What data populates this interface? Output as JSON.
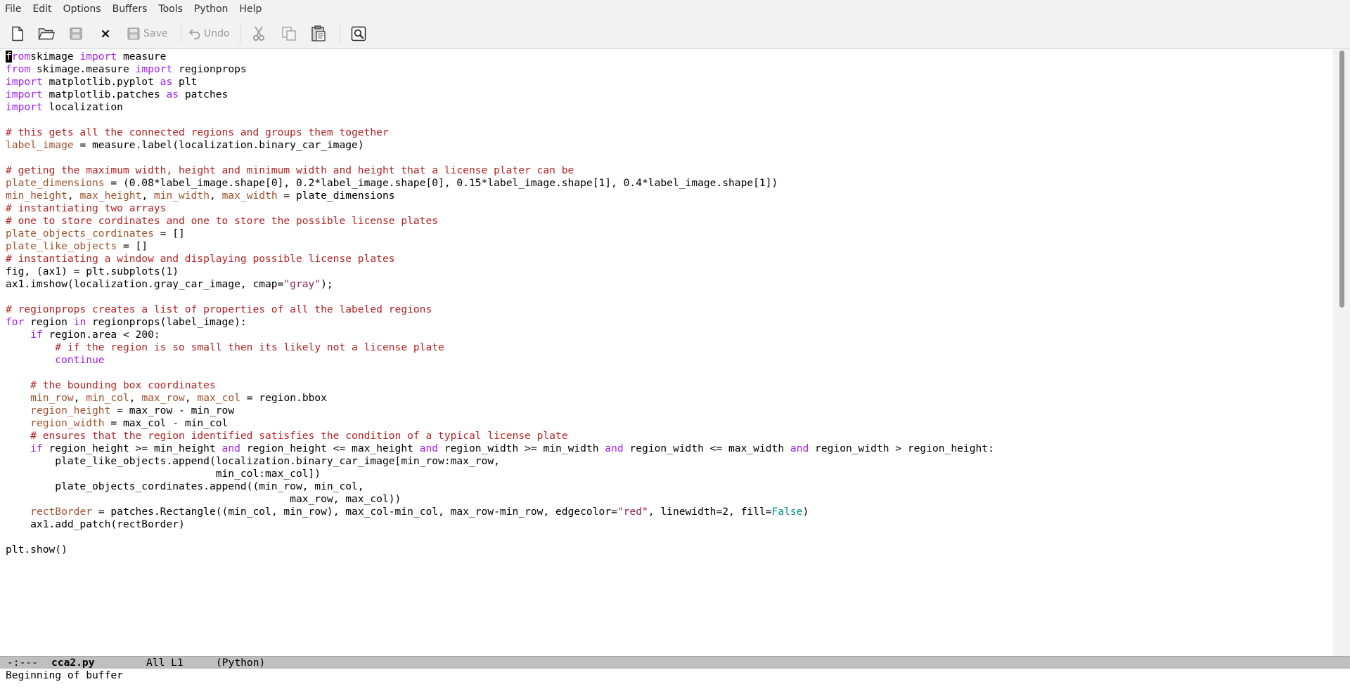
{
  "menubar": {
    "items": [
      "File",
      "Edit",
      "Options",
      "Buffers",
      "Tools",
      "Python",
      "Help"
    ]
  },
  "toolbar": {
    "save_label": "Save",
    "undo_label": "Undo",
    "icons": [
      "new-file-icon",
      "open-folder-icon",
      "disk-icon",
      "close-icon",
      "save-icon",
      "undo-icon",
      "cut-icon",
      "copy-icon",
      "paste-icon",
      "search-icon"
    ]
  },
  "editor": {
    "lines": [
      [
        [
          "kw",
          "from"
        ],
        [
          "",
          "skimage "
        ],
        [
          "kw",
          "import"
        ],
        [
          "",
          " measure"
        ]
      ],
      [
        [
          "kw",
          "from"
        ],
        [
          "",
          " skimage.measure "
        ],
        [
          "kw",
          "import"
        ],
        [
          "",
          " regionprops"
        ]
      ],
      [
        [
          "kw",
          "import"
        ],
        [
          "",
          " matplotlib.pyplot "
        ],
        [
          "kw",
          "as"
        ],
        [
          "",
          " plt"
        ]
      ],
      [
        [
          "kw",
          "import"
        ],
        [
          "",
          " matplotlib.patches "
        ],
        [
          "kw",
          "as"
        ],
        [
          "",
          " patches"
        ]
      ],
      [
        [
          "kw",
          "import"
        ],
        [
          "",
          " localization"
        ]
      ],
      [],
      [
        [
          "cm",
          "# this gets all the connected regions and groups them together"
        ]
      ],
      [
        [
          "vr",
          "label_image"
        ],
        [
          "",
          " = measure.label(localization.binary_car_image)"
        ]
      ],
      [],
      [
        [
          "cm",
          "# geting the maximum width, height and minimum width and height that a license plater can be"
        ]
      ],
      [
        [
          "vr",
          "plate_dimensions"
        ],
        [
          "",
          " = (0.08*label_image.shape[0], 0.2*label_image.shape[0], 0.15*label_image.shape[1], 0.4*label_image.shape[1])"
        ]
      ],
      [
        [
          "vr",
          "min_height"
        ],
        [
          "",
          ", "
        ],
        [
          "vr",
          "max_height"
        ],
        [
          "",
          ", "
        ],
        [
          "vr",
          "min_width"
        ],
        [
          "",
          ", "
        ],
        [
          "vr",
          "max_width"
        ],
        [
          "",
          " = plate_dimensions"
        ]
      ],
      [
        [
          "cm",
          "# instantiating two arrays"
        ]
      ],
      [
        [
          "cm",
          "# one to store cordinates and one to store the possible license plates"
        ]
      ],
      [
        [
          "vr",
          "plate_objects_cordinates"
        ],
        [
          "",
          " = []"
        ]
      ],
      [
        [
          "vr",
          "plate_like_objects"
        ],
        [
          "",
          " = []"
        ]
      ],
      [
        [
          "cm",
          "# instantiating a window and displaying possible license plates"
        ]
      ],
      [
        [
          "",
          "fig, (ax1) = plt.subplots(1)"
        ]
      ],
      [
        [
          "",
          "ax1.imshow(localization.gray_car_image, cmap="
        ],
        [
          "st",
          "\"gray\""
        ],
        [
          "",
          ");"
        ]
      ],
      [],
      [
        [
          "cm",
          "# regionprops creates a list of properties of all the labeled regions"
        ]
      ],
      [
        [
          "kw",
          "for"
        ],
        [
          "",
          " region "
        ],
        [
          "kw",
          "in"
        ],
        [
          "",
          " regionprops(label_image):"
        ]
      ],
      [
        [
          "",
          "    "
        ],
        [
          "kw",
          "if"
        ],
        [
          "",
          " region.area < 200:"
        ]
      ],
      [
        [
          "",
          "        "
        ],
        [
          "cm",
          "# if the region is so small then its likely not a license plate"
        ]
      ],
      [
        [
          "",
          "        "
        ],
        [
          "kw",
          "continue"
        ]
      ],
      [],
      [
        [
          "",
          "    "
        ],
        [
          "cm",
          "# the bounding box coordinates"
        ]
      ],
      [
        [
          "",
          "    "
        ],
        [
          "vr",
          "min_row"
        ],
        [
          "",
          ", "
        ],
        [
          "vr",
          "min_col"
        ],
        [
          "",
          ", "
        ],
        [
          "vr",
          "max_row"
        ],
        [
          "",
          ", "
        ],
        [
          "vr",
          "max_col"
        ],
        [
          "",
          " = region.bbox"
        ]
      ],
      [
        [
          "",
          "    "
        ],
        [
          "vr",
          "region_height"
        ],
        [
          "",
          " = max_row - min_row"
        ]
      ],
      [
        [
          "",
          "    "
        ],
        [
          "vr",
          "region_width"
        ],
        [
          "",
          " = max_col - min_col"
        ]
      ],
      [
        [
          "",
          "    "
        ],
        [
          "cm",
          "# ensures that the region identified satisfies the condition of a typical license plate"
        ]
      ],
      [
        [
          "",
          "    "
        ],
        [
          "kw",
          "if"
        ],
        [
          "",
          " region_height >= min_height "
        ],
        [
          "kw",
          "and"
        ],
        [
          "",
          " region_height <= max_height "
        ],
        [
          "kw",
          "and"
        ],
        [
          "",
          " region_width >= min_width "
        ],
        [
          "kw",
          "and"
        ],
        [
          "",
          " region_width <= max_width "
        ],
        [
          "kw",
          "and"
        ],
        [
          "",
          " region_width > region_height:"
        ]
      ],
      [
        [
          "",
          "        plate_like_objects.append(localization.binary_car_image[min_row:max_row,"
        ]
      ],
      [
        [
          "",
          "                                  min_col:max_col])"
        ]
      ],
      [
        [
          "",
          "        plate_objects_cordinates.append((min_row, min_col,"
        ]
      ],
      [
        [
          "",
          "                                              max_row, max_col))"
        ]
      ],
      [
        [
          "",
          "    "
        ],
        [
          "vr",
          "rectBorder"
        ],
        [
          "",
          " = patches.Rectangle((min_col, min_row), max_col-min_col, max_row-min_row, edgecolor="
        ],
        [
          "st",
          "\"red\""
        ],
        [
          "",
          ", linewidth=2, fill="
        ],
        [
          "cn",
          "False"
        ],
        [
          "",
          ")"
        ]
      ],
      [
        [
          "",
          "    ax1.add_patch(rectBorder)"
        ]
      ],
      [],
      [
        [
          "",
          "plt.show()"
        ]
      ]
    ]
  },
  "modeline": {
    "status": "-:---",
    "buffer_name": "cca2.py",
    "position": "All L1",
    "mode": "(Python)"
  },
  "minibuffer": {
    "message": "Beginning of buffer"
  },
  "colors": {
    "keyword": "#a020f0",
    "comment": "#b22222",
    "variable": "#a0522d",
    "string": "#8b2252",
    "constant": "#008b8b",
    "modeline_bg": "#bfbfbf"
  }
}
